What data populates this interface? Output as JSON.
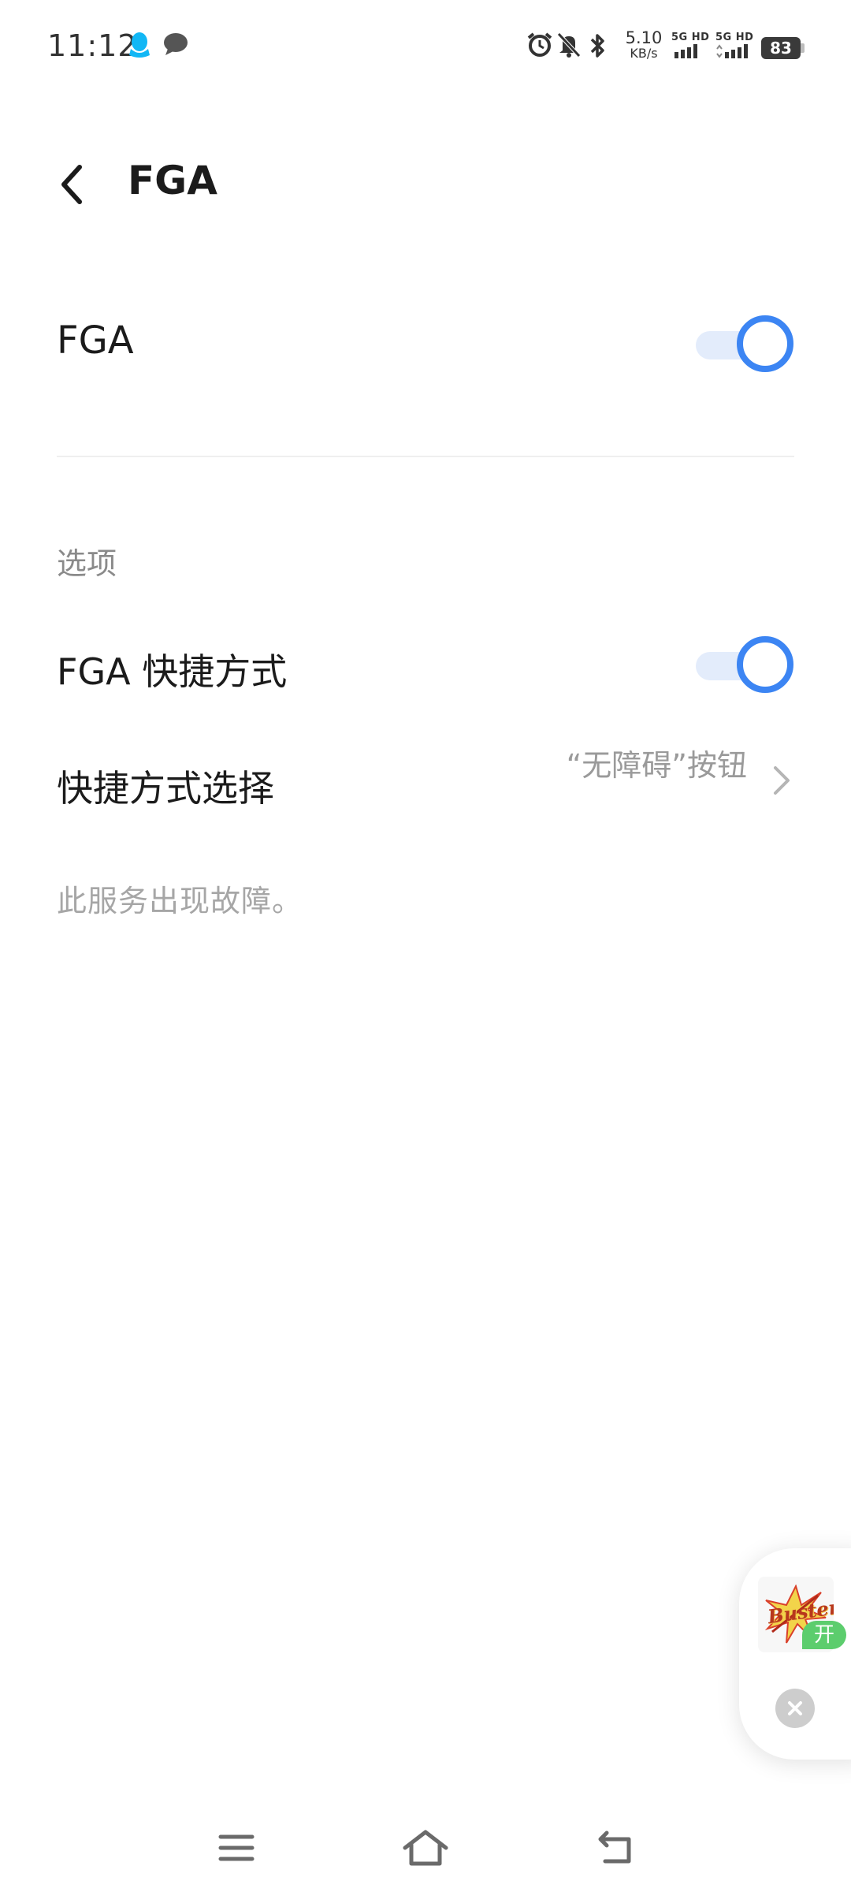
{
  "status_bar": {
    "time": "11:12",
    "net_speed_value": "5.10",
    "net_speed_unit": "KB/s",
    "sim1_label": "5G HD",
    "sim2_label": "5G HD",
    "battery_level": "83",
    "icons": [
      "qq-icon",
      "chat-bubble-icon",
      "alarm-icon",
      "bell-mute-icon",
      "bluetooth-icon",
      "signal-icon",
      "battery-icon"
    ]
  },
  "header": {
    "title": "FGA"
  },
  "main_toggle": {
    "label": "FGA",
    "enabled": true
  },
  "options": {
    "section_title": "选项",
    "shortcut_toggle": {
      "label": "FGA 快捷方式",
      "enabled": true
    },
    "shortcut_select": {
      "label": "快捷方式选择",
      "value": "“无障碍”按钮"
    },
    "error_message": "此服务出现故障。"
  },
  "floating_widget": {
    "thumb_text": "Buster",
    "badge": "开"
  },
  "colors": {
    "accent": "#3c85f3",
    "toggle_track": "#e3ecfb",
    "badge_green": "#5ccd6d"
  }
}
